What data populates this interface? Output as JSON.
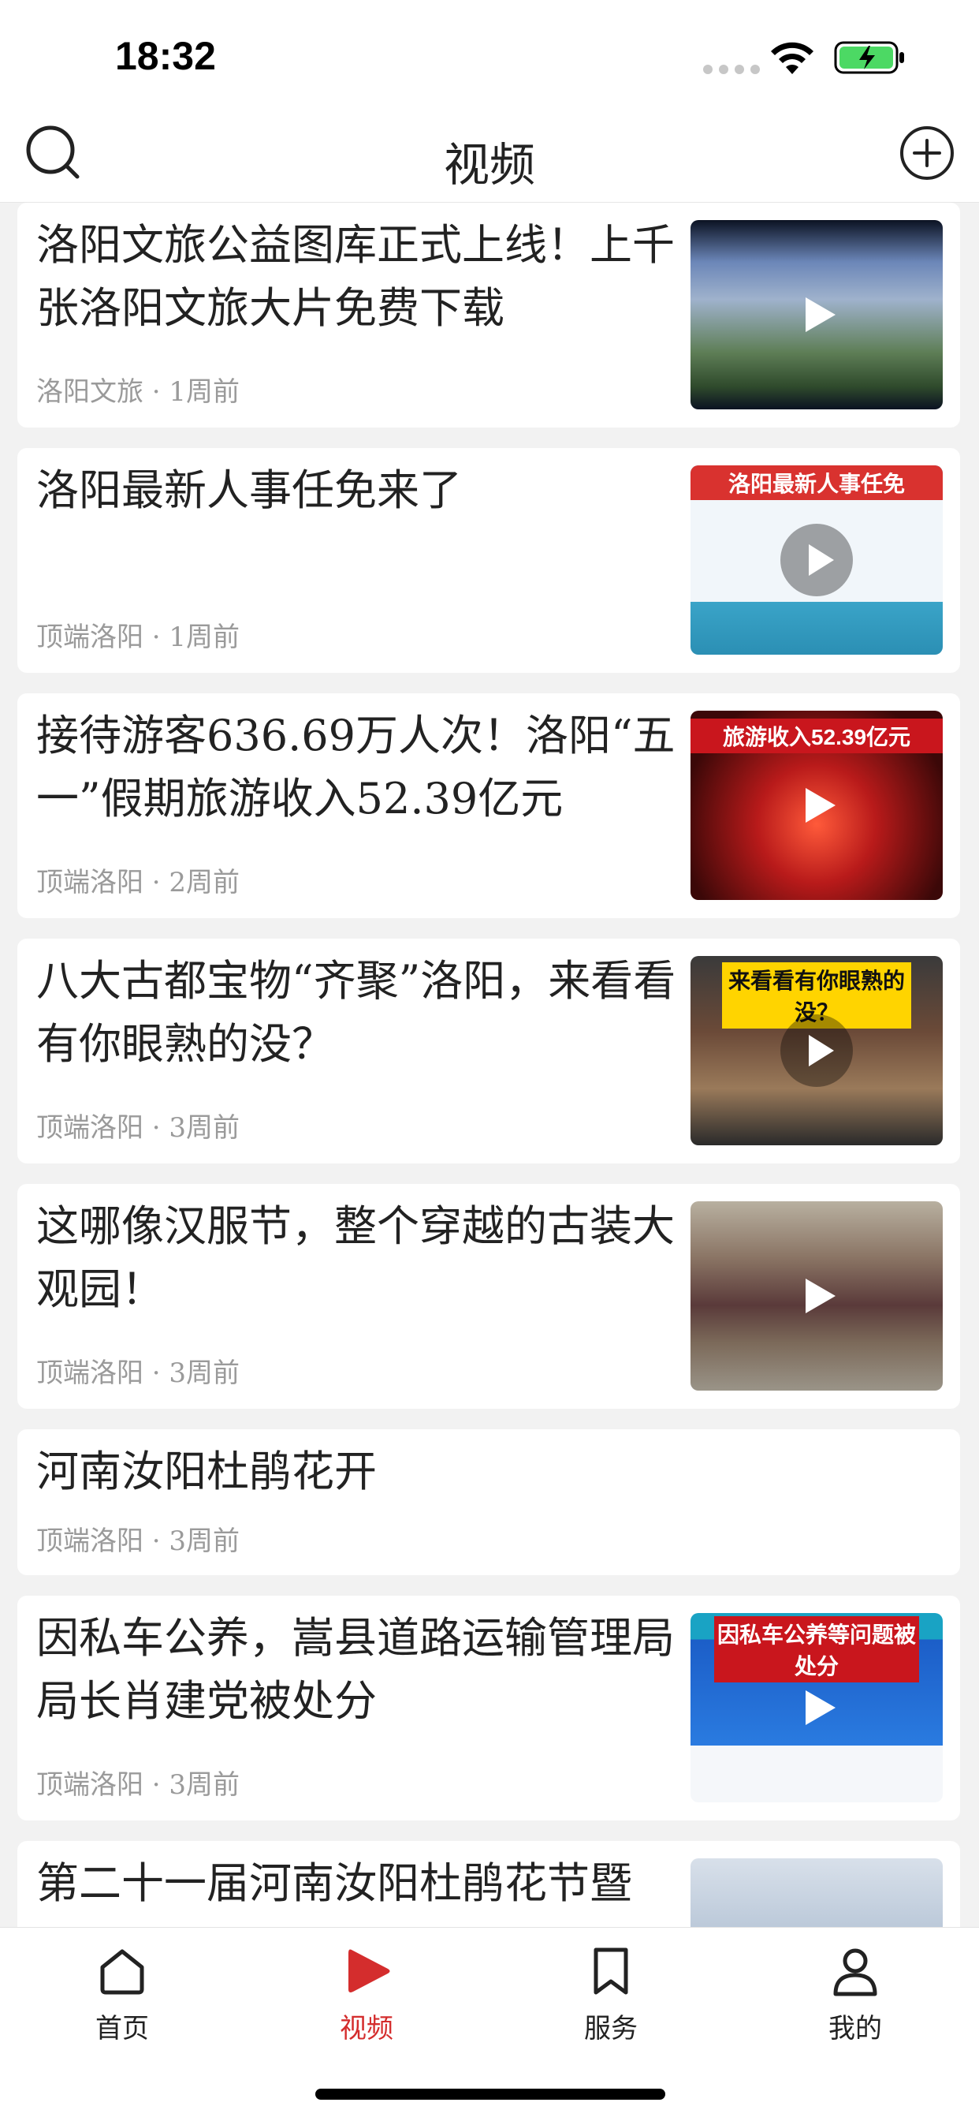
{
  "status": {
    "time": "18:32"
  },
  "nav": {
    "title": "视频"
  },
  "colors": {
    "accent": "#d42d2d"
  },
  "icons": {
    "search": "search-icon",
    "add": "plus-circle-icon",
    "play": "play-icon"
  },
  "feed": [
    {
      "title": "洛阳文旅公益图库正式上线！上千张洛阳文旅大片免费下载",
      "meta": "洛阳文旅 · 1周前",
      "thumb_caption": ""
    },
    {
      "title": "洛阳最新人事任免来了",
      "meta": "顶端洛阳 · 1周前",
      "thumb_caption": "洛阳最新人事任免"
    },
    {
      "title": "接待游客636.69万人次！洛阳“五一”假期旅游收入52.39亿元",
      "meta": "顶端洛阳 · 2周前",
      "thumb_caption": "旅游收入52.39亿元"
    },
    {
      "title": "八大古都宝物“齐聚”洛阳，来看看有你眼熟的没？",
      "meta": "顶端洛阳 · 3周前",
      "thumb_caption": "来看看有你眼熟的没？"
    },
    {
      "title": "这哪像汉服节，整个穿越的古装大观园！",
      "meta": "顶端洛阳 · 3周前",
      "thumb_caption": ""
    },
    {
      "title": "河南汝阳杜鹃花开",
      "meta": "顶端洛阳 · 3周前"
    },
    {
      "title": "因私车公养，嵩县道路运输管理局局长肖建党被处分",
      "meta": "顶端洛阳 · 3周前",
      "thumb_caption": "因私车公养等问题被处分"
    },
    {
      "title": "第二十一届河南汝阳杜鹃花节暨",
      "meta": ""
    }
  ],
  "tabs": [
    {
      "label": "首页",
      "icon": "home-icon"
    },
    {
      "label": "视频",
      "icon": "video-play-icon",
      "active": true
    },
    {
      "label": "服务",
      "icon": "bookmark-icon"
    },
    {
      "label": "我的",
      "icon": "person-icon"
    }
  ]
}
